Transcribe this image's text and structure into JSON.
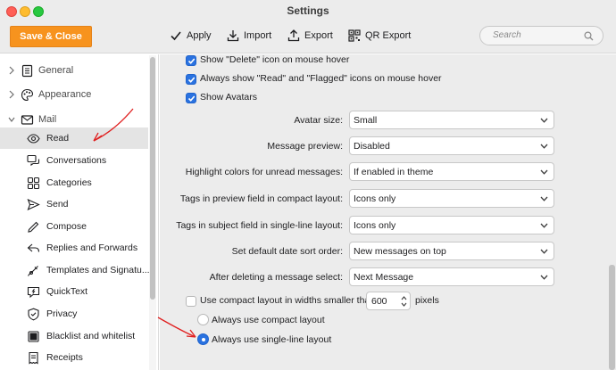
{
  "window": {
    "title": "Settings"
  },
  "toolbar": {
    "save_label": "Save & Close",
    "apply_label": "Apply",
    "import_label": "Import",
    "export_label": "Export",
    "qr_export_label": "QR Export",
    "search_placeholder": "Search",
    "accent_color": "#f7931e"
  },
  "sidebar": {
    "groups": [
      {
        "label": "General",
        "icon": "general-icon",
        "expanded": false
      },
      {
        "label": "Appearance",
        "icon": "palette-icon",
        "expanded": false
      },
      {
        "label": "Mail",
        "icon": "mail-icon",
        "expanded": true
      }
    ],
    "items": [
      {
        "label": "Read",
        "icon": "eye-icon",
        "selected": true
      },
      {
        "label": "Conversations",
        "icon": "conversations-icon"
      },
      {
        "label": "Categories",
        "icon": "categories-icon"
      },
      {
        "label": "Send",
        "icon": "send-icon"
      },
      {
        "label": "Compose",
        "icon": "pencil-icon"
      },
      {
        "label": "Replies and Forwards",
        "icon": "reply-icon"
      },
      {
        "label": "Templates and Signatu...",
        "icon": "templates-icon"
      },
      {
        "label": "QuickText",
        "icon": "quicktext-icon"
      },
      {
        "label": "Privacy",
        "icon": "shield-icon"
      },
      {
        "label": "Blacklist and whitelist",
        "icon": "blacklist-icon"
      },
      {
        "label": "Receipts",
        "icon": "receipt-icon"
      }
    ]
  },
  "settings": {
    "checkboxes": [
      {
        "label": "Show \"Delete\" icon on mouse hover",
        "checked": true
      },
      {
        "label": "Always show \"Read\" and \"Flagged\" icons on mouse hover",
        "checked": true
      },
      {
        "label": "Show Avatars",
        "checked": true
      }
    ],
    "dropdowns": [
      {
        "label": "Avatar size:",
        "value": "Small"
      },
      {
        "label": "Message preview:",
        "value": "Disabled"
      },
      {
        "label": "Highlight colors for unread messages:",
        "value": "If enabled in theme"
      },
      {
        "label": "Tags in preview field in compact layout:",
        "value": "Icons only"
      },
      {
        "label": "Tags in subject field in single-line layout:",
        "value": "Icons only"
      },
      {
        "label": "Set default date sort order:",
        "value": "New messages on top"
      },
      {
        "label": "After deleting a message select:",
        "value": "Next Message"
      }
    ],
    "compact_layout": {
      "label": "Use compact layout in widths smaller than",
      "checked": false,
      "width_value": "600",
      "unit": "pixels"
    },
    "layout_options": [
      {
        "label": "Always use compact layout",
        "selected": false
      },
      {
        "label": "Always use single-line layout",
        "selected": true
      }
    ]
  },
  "annotation": {
    "arrow_color": "#e02020"
  }
}
